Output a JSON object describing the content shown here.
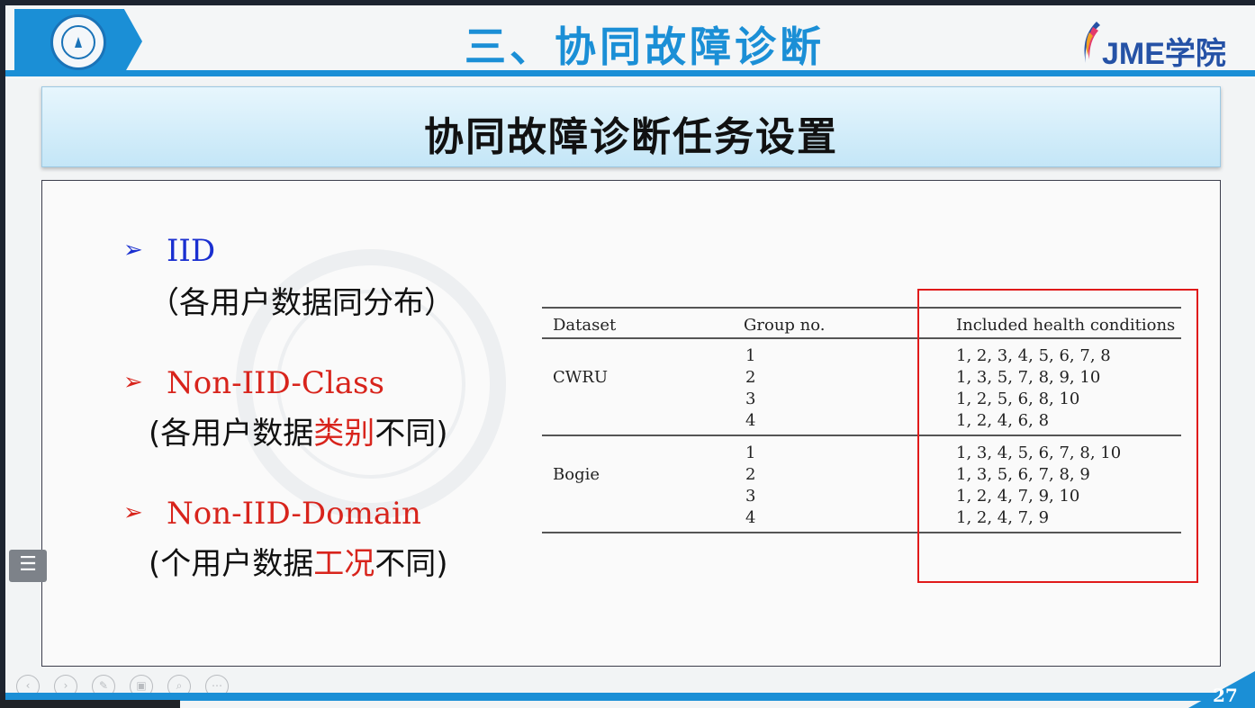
{
  "header": {
    "title": "三、协同故障诊断",
    "brand": "JME学院"
  },
  "banner": {
    "title": "协同故障诊断任务设置"
  },
  "bullets": [
    {
      "label": "IID",
      "desc_pre": "（各用户数据同分布）",
      "desc_hl": "",
      "desc_post": ""
    },
    {
      "label": "Non-IID-Class",
      "desc_pre": "(各用户数据",
      "desc_hl": "类别",
      "desc_post": "不同)"
    },
    {
      "label": "Non-IID-Domain",
      "desc_pre": "(个用户数据",
      "desc_hl": "工况",
      "desc_post": "不同)"
    }
  ],
  "bullet_marker": "➢",
  "table": {
    "headers": [
      "Dataset",
      "Group no.",
      "Included health conditions"
    ],
    "groups": [
      {
        "dataset": "CWRU",
        "rows": [
          {
            "group": "1",
            "conditions": "1, 2, 3, 4, 5, 6, 7, 8"
          },
          {
            "group": "2",
            "conditions": "1, 3, 5, 7, 8, 9, 10"
          },
          {
            "group": "3",
            "conditions": "1, 2, 5, 6, 8, 10"
          },
          {
            "group": "4",
            "conditions": "1, 2, 4, 6, 8"
          }
        ]
      },
      {
        "dataset": "Bogie",
        "rows": [
          {
            "group": "1",
            "conditions": "1, 3, 4, 5, 6, 7, 8, 10"
          },
          {
            "group": "2",
            "conditions": "1, 3, 5, 6, 7, 8, 9"
          },
          {
            "group": "3",
            "conditions": "1, 2, 4, 7, 9, 10"
          },
          {
            "group": "4",
            "conditions": "1, 2, 4, 7, 9"
          }
        ]
      }
    ]
  },
  "page_number": "27",
  "colors": {
    "accent": "#1b8fd6",
    "highlight_red": "#d8241c",
    "iid_blue": "#1a2fd0",
    "frame_red": "#e01a1a"
  },
  "icons": [
    "university-emblem-icon",
    "jme-logo-icon",
    "table-of-contents-icon",
    "player-control-icons"
  ]
}
